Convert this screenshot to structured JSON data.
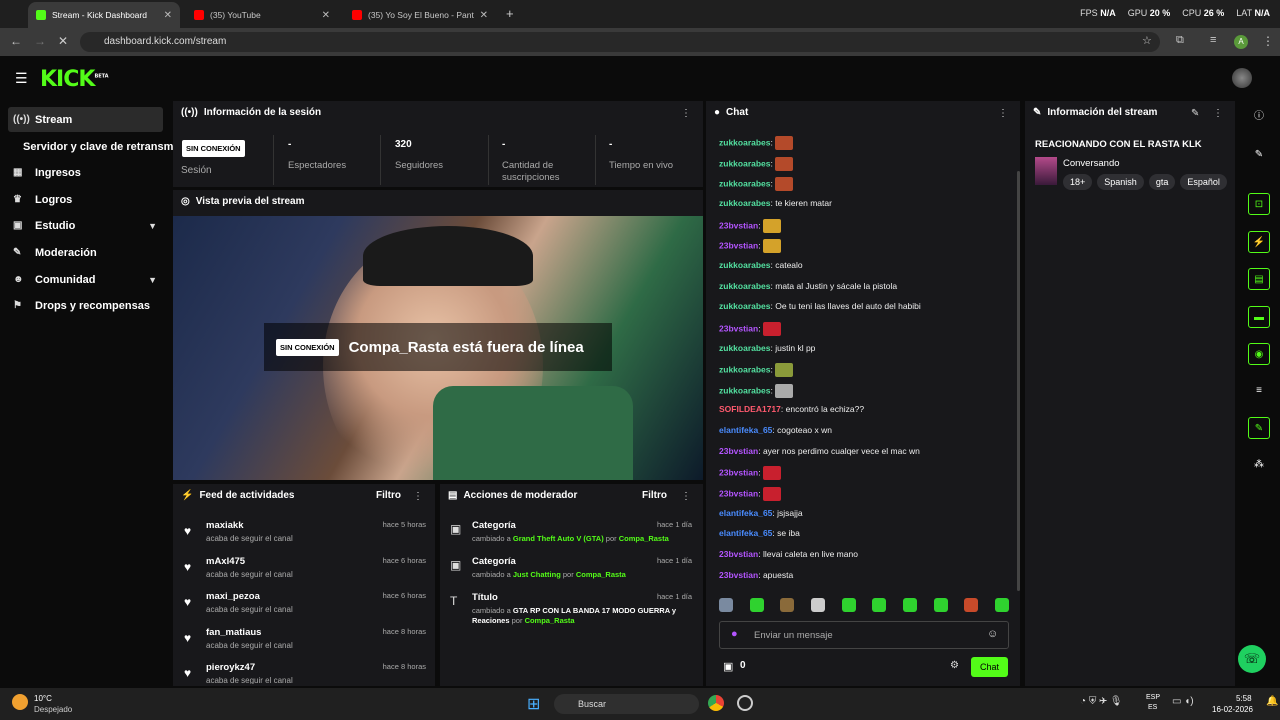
{
  "browser": {
    "tabs": [
      {
        "title": "Stream - Kick Dashboard",
        "fav_color": "#53fc18"
      },
      {
        "title": "(35) YouTube",
        "fav_color": "#ff0000"
      },
      {
        "title": "(35) Yo Soy El Bueno - Pant",
        "fav_color": "#ff0000"
      }
    ],
    "new_tab": "+",
    "url": "dashboard.kick.com/stream",
    "perf": {
      "fps_label": "FPS",
      "fps": "N/A",
      "gpu_label": "GPU",
      "gpu": "20 %",
      "cpu_label": "CPU",
      "cpu": "26 %",
      "lat_label": "LAT",
      "lat": "N/A"
    },
    "profile_initial": "A"
  },
  "app": {
    "logo": "KICK",
    "logo_sup": "BETA"
  },
  "sidebar": {
    "items": [
      {
        "label": "Stream",
        "icon": "stream-icon"
      },
      {
        "label": "Servidor y clave de retransm",
        "icon": ""
      },
      {
        "label": "Ingresos",
        "icon": "chart-icon"
      },
      {
        "label": "Logros",
        "icon": "trophy-icon"
      },
      {
        "label": "Estudio",
        "icon": "studio-icon"
      },
      {
        "label": "Moderación",
        "icon": "wrench-icon"
      },
      {
        "label": "Comunidad",
        "icon": "people-icon"
      },
      {
        "label": "Drops y recompensas",
        "icon": "drops-icon"
      }
    ]
  },
  "session": {
    "title": "Información de la sesión",
    "status_badge": "SIN CONEXIÓN",
    "status_label": "Sesión",
    "stats": [
      {
        "value": "-",
        "label": "Espectadores"
      },
      {
        "value": "320",
        "label": "Seguidores"
      },
      {
        "value": "-",
        "label": "Cantidad de suscripciones"
      },
      {
        "value": "-",
        "label": "Tiempo en vivo"
      }
    ]
  },
  "preview": {
    "title": "Vista previa del stream",
    "badge": "SIN CONEXIÓN",
    "offline_text": "Compa_Rasta está fuera de línea"
  },
  "feed": {
    "title": "Feed de actividades",
    "filter": "Filtro",
    "items": [
      {
        "name": "maxiakk",
        "sub": "acaba de seguir el canal",
        "time": "hace 5 horas"
      },
      {
        "name": "mAxl475",
        "sub": "acaba de seguir el canal",
        "time": "hace 6 horas"
      },
      {
        "name": "maxi_pezoa",
        "sub": "acaba de seguir el canal",
        "time": "hace 6 horas"
      },
      {
        "name": "fan_matiaus",
        "sub": "acaba de seguir el canal",
        "time": "hace 8 horas"
      },
      {
        "name": "pieroykz47",
        "sub": "acaba de seguir el canal",
        "time": "hace 8 horas"
      }
    ]
  },
  "mod": {
    "title": "Acciones de moderador",
    "filter": "Filtro",
    "items": [
      {
        "title": "Categoría",
        "time": "hace 1 día",
        "pre": "cambiado a",
        "value": "Grand Theft Auto V (GTA)",
        "by": "por",
        "user": "Compa_Rasta"
      },
      {
        "title": "Categoría",
        "time": "hace 1 día",
        "pre": "cambiado a",
        "value": "Just Chatting",
        "by": "por",
        "user": "Compa_Rasta"
      },
      {
        "title": "Título",
        "time": "hace 1 día",
        "pre": "cambiado a",
        "value": "GTA RP CON LA BANDA 17 MODO GUERRA y Reaciones",
        "by": "por",
        "user": "Compa_Rasta"
      }
    ]
  },
  "chat": {
    "title": "Chat",
    "placeholder": "Enviar un mensaje",
    "count": "0",
    "send": "Chat",
    "messages": [
      {
        "user": "zukkoarabes",
        "color": "#53e0a0",
        "text": "",
        "emote": "#b44a2a"
      },
      {
        "user": "zukkoarabes",
        "color": "#53e0a0",
        "text": "",
        "emote": "#b44a2a"
      },
      {
        "user": "zukkoarabes",
        "color": "#53e0a0",
        "text": "",
        "emote": "#b44a2a"
      },
      {
        "user": "zukkoarabes",
        "color": "#53e0a0",
        "text": "te kieren matar",
        "emote": ""
      },
      {
        "user": "23bvstian",
        "color": "#b455ff",
        "text": "",
        "emote": "#d4a22a"
      },
      {
        "user": "23bvstian",
        "color": "#b455ff",
        "text": "",
        "emote": "#d4a22a"
      },
      {
        "user": "zukkoarabes",
        "color": "#53e0a0",
        "text": "catealo",
        "emote": ""
      },
      {
        "user": "zukkoarabes",
        "color": "#53e0a0",
        "text": "mata al Justin y sácale la pistola",
        "emote": ""
      },
      {
        "user": "zukkoarabes",
        "color": "#53e0a0",
        "text": "Oe tu teni las llaves del auto del habibi",
        "emote": ""
      },
      {
        "user": "23bvstian",
        "color": "#b455ff",
        "text": "",
        "emote": "#c8202e"
      },
      {
        "user": "zukkoarabes",
        "color": "#53e0a0",
        "text": "justin kl pp",
        "emote": ""
      },
      {
        "user": "zukkoarabes",
        "color": "#53e0a0",
        "text": "",
        "emote": "#8a9a3a"
      },
      {
        "user": "zukkoarabes",
        "color": "#53e0a0",
        "text": "",
        "emote": "#aaaaaa"
      },
      {
        "user": "SOFILDEA1717",
        "color": "#ff5a6e",
        "text": "encontró la echiza??",
        "emote": ""
      },
      {
        "user": "elantifeka_65",
        "color": "#4a8cff",
        "text": "cogoteao x wn",
        "emote": ""
      },
      {
        "user": "23bvstian",
        "color": "#b455ff",
        "text": "ayer nos perdimo cualqer vece el mac wn",
        "emote": ""
      },
      {
        "user": "23bvstian",
        "color": "#b455ff",
        "text": "",
        "emote": "#c8202e"
      },
      {
        "user": "23bvstian",
        "color": "#b455ff",
        "text": "",
        "emote": "#c8202e"
      },
      {
        "user": "elantifeka_65",
        "color": "#4a8cff",
        "text": "jsjsajja",
        "emote": ""
      },
      {
        "user": "elantifeka_65",
        "color": "#4a8cff",
        "text": "se iba",
        "emote": ""
      },
      {
        "user": "23bvstian",
        "color": "#b455ff",
        "text": "llevai caleta en live mano",
        "emote": ""
      },
      {
        "user": "23bvstian",
        "color": "#b455ff",
        "text": "apuesta",
        "emote": ""
      }
    ],
    "emote_colors": [
      "#7a8aa0",
      "#2fd22f",
      "#8a6a3a",
      "#cccccc",
      "#2fd22f",
      "#2fd22f",
      "#2fd22f",
      "#2fd22f",
      "#c84a2a",
      "#2fd22f"
    ]
  },
  "stream_info": {
    "title": "Información del stream",
    "stream_title": "REACIONANDO CON EL RASTA KLK",
    "category": "Conversando",
    "tags": [
      "18+",
      "Spanish",
      "gta",
      "Español"
    ]
  },
  "taskbar": {
    "weather_temp": "10°C",
    "weather_desc": "Despejado",
    "search": "Buscar",
    "lang1": "ESP",
    "lang2": "ES",
    "time": "5:58",
    "date": "16-02-2026"
  },
  "colors": {
    "accent": "#53fc18",
    "panel": "#18181b",
    "background": "#0b0b0b"
  }
}
